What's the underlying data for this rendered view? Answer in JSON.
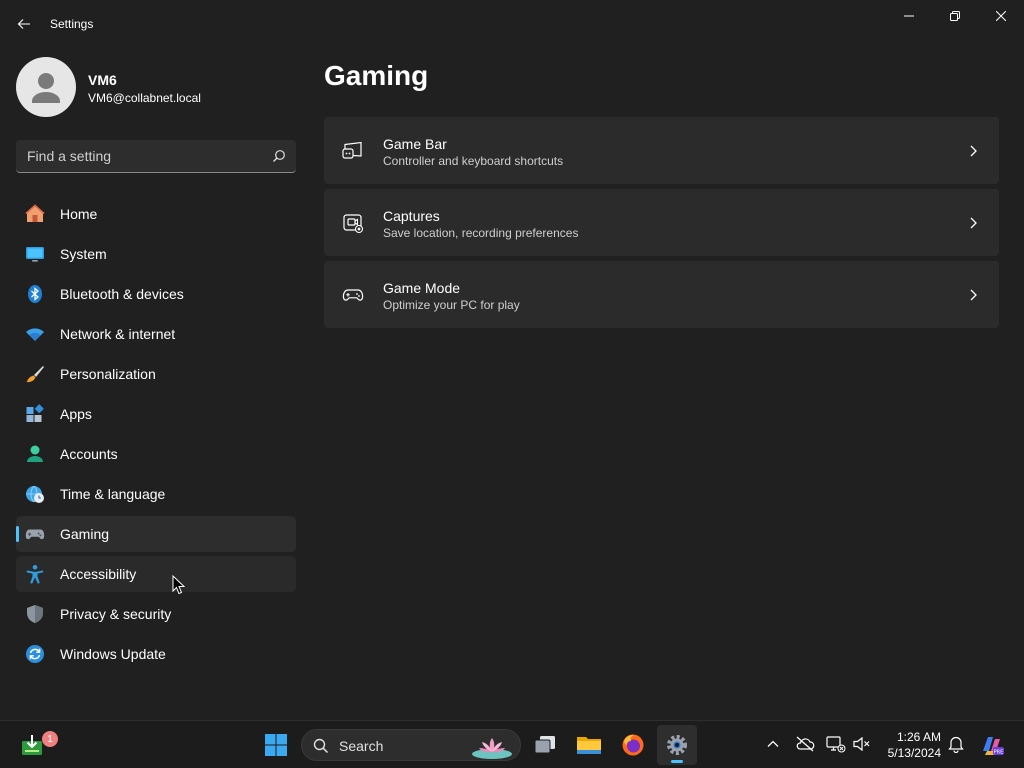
{
  "window": {
    "title": "Settings"
  },
  "profile": {
    "name": "VM6",
    "email": "VM6@collabnet.local"
  },
  "search": {
    "placeholder": "Find a setting"
  },
  "nav": {
    "items": [
      {
        "label": "Home",
        "icon": "home-icon"
      },
      {
        "label": "System",
        "icon": "system-icon"
      },
      {
        "label": "Bluetooth & devices",
        "icon": "bluetooth-icon"
      },
      {
        "label": "Network & internet",
        "icon": "wifi-icon"
      },
      {
        "label": "Personalization",
        "icon": "brush-icon"
      },
      {
        "label": "Apps",
        "icon": "apps-icon"
      },
      {
        "label": "Accounts",
        "icon": "accounts-icon"
      },
      {
        "label": "Time & language",
        "icon": "globe-clock-icon"
      },
      {
        "label": "Gaming",
        "icon": "gamepad-icon",
        "selected": true
      },
      {
        "label": "Accessibility",
        "icon": "accessibility-icon",
        "hover": true
      },
      {
        "label": "Privacy & security",
        "icon": "shield-icon"
      },
      {
        "label": "Windows Update",
        "icon": "update-icon"
      }
    ]
  },
  "main": {
    "title": "Gaming",
    "cards": [
      {
        "title": "Game Bar",
        "subtitle": "Controller and keyboard shortcuts",
        "icon": "game-bar-icon"
      },
      {
        "title": "Captures",
        "subtitle": "Save location, recording preferences",
        "icon": "capture-icon"
      },
      {
        "title": "Game Mode",
        "subtitle": "Optimize your PC for play",
        "icon": "game-mode-icon"
      }
    ]
  },
  "taskbar": {
    "search_label": "Search",
    "notification_badge": "1",
    "time": "1:26 AM",
    "date": "5/13/2024"
  },
  "colors": {
    "accent": "#4cc2ff",
    "background": "#202020",
    "card": "#2b2b2b"
  }
}
